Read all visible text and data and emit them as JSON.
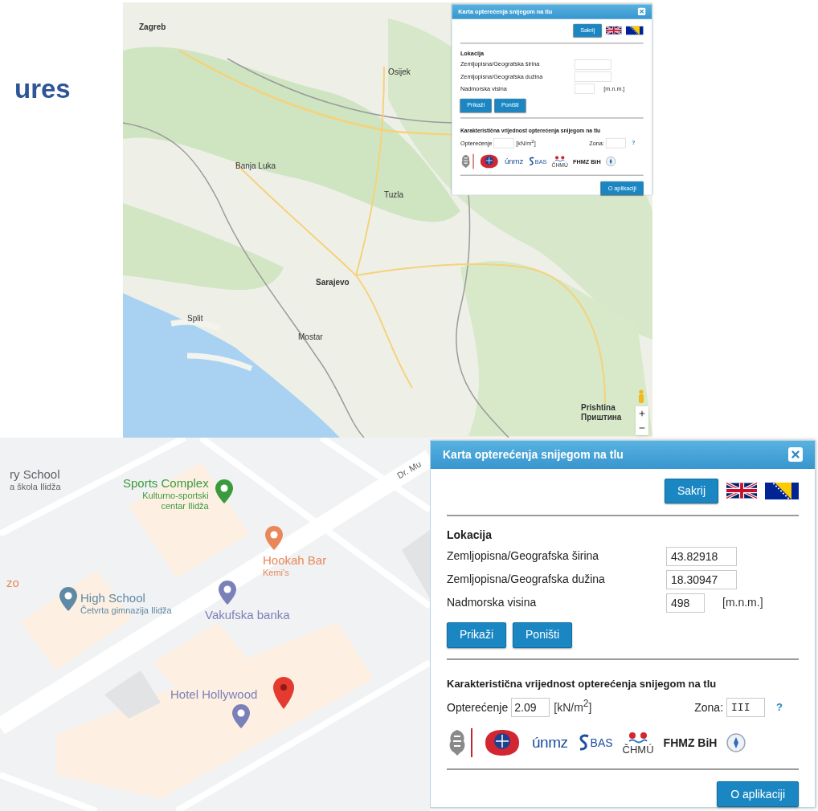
{
  "heading_fragment": "ures",
  "overview_screenshot": {
    "map_labels": [
      "Zagreb",
      "Osijek",
      "Banja Luka",
      "Tuzla",
      "Sarajevo",
      "Split",
      "Mostar",
      "Prishtina",
      "Приштина"
    ],
    "dialog": {
      "title": "Karta opterećenja snijegom na tlu",
      "hide_button": "Sakrij",
      "location_heading": "Lokacija",
      "fields": [
        {
          "label": "Zemljopisna/Geografska širina"
        },
        {
          "label": "Zemljopisna/Geografska dužina"
        },
        {
          "label": "Nadmorska visina",
          "unit": "[m.n.m.]"
        }
      ],
      "action_buttons": [
        "Prikaži",
        "Poništi"
      ],
      "result_heading": "Karakteristična vrijednost opterećenja snijegom na tlu",
      "load": {
        "label": "Opterećenje",
        "unit": "[kN/m$^{2}$]"
      },
      "zone": {
        "label": "Zona:"
      },
      "help": "?",
      "logos": [
        {
          "kind": "crest"
        },
        {
          "kind": "globe"
        },
        {
          "kind": "wordmark",
          "text": "únmz"
        },
        {
          "kind": "swirl",
          "text": "BAS"
        },
        {
          "kind": "dots",
          "text": "ČHMÚ"
        },
        {
          "kind": "bold",
          "text": "FHMZ BiH"
        },
        {
          "kind": "seal"
        }
      ],
      "about_button": "O aplikaciji"
    }
  },
  "detail_screenshot": {
    "map_labels": [
      {
        "kind": "poi",
        "title": "ry School",
        "subtitle": "a škola Ilidža",
        "color": "#5f6368"
      },
      {
        "kind": "poi",
        "title": "Sports Complex",
        "subtitle": "Kulturno-sportski centar Ilidža",
        "color": "#3a9b3e",
        "pin": true
      },
      {
        "kind": "poi",
        "title": "Hookah Bar",
        "subtitle": "Kemi's",
        "color": "#e8885a",
        "pin": true
      },
      {
        "kind": "poi",
        "title": "zo",
        "color": "#e8885a"
      },
      {
        "kind": "poi",
        "title": "High School",
        "subtitle": "Četvrta gimnazija Ilidža",
        "color": "#5f8aa5",
        "pin": true
      },
      {
        "kind": "poi",
        "title": "Vakufska banka",
        "color": "#7b80b8",
        "pin": true
      },
      {
        "kind": "poi",
        "title": "Hotel Hollywood",
        "color": "#7b80b8",
        "pin": true
      },
      {
        "kind": "road",
        "title": "Dr. Mu"
      }
    ],
    "dialog": {
      "title": "Karta opterećenja snijegom na tlu",
      "hide_button": "Sakrij",
      "location_heading": "Lokacija",
      "fields": [
        {
          "label": "Zemljopisna/Geografska širina",
          "value": "43.82918"
        },
        {
          "label": "Zemljopisna/Geografska dužina",
          "value": "18.30947"
        },
        {
          "label": "Nadmorska visina",
          "value": "498",
          "unit": "[m.n.m.]"
        }
      ],
      "action_buttons": [
        "Prikaži",
        "Poništi"
      ],
      "result_heading": "Karakteristična vrijednost opterećenja snijegom na tlu",
      "load": {
        "label": "Opterećenje",
        "value": "2.09",
        "unit": "[kN/m$^{2}$]"
      },
      "zone": {
        "label": "Zona:",
        "value": "III"
      },
      "help": "?",
      "logos": [
        {
          "kind": "crest"
        },
        {
          "kind": "globe"
        },
        {
          "kind": "wordmark",
          "text": "únmz"
        },
        {
          "kind": "swirl",
          "text": "BAS"
        },
        {
          "kind": "dots",
          "text": "ČHMÚ"
        },
        {
          "kind": "bold",
          "text": "FHMZ BiH"
        },
        {
          "kind": "seal"
        }
      ],
      "about_button": "O aplikaciji"
    }
  }
}
